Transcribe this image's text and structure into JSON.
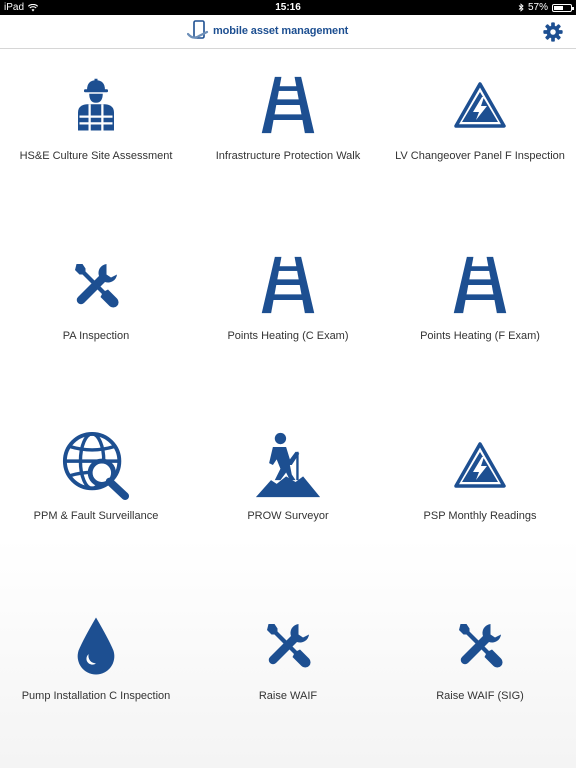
{
  "status": {
    "device": "iPad",
    "time": "15:16",
    "battery": "57%",
    "battery_level": 0.57
  },
  "header": {
    "brand": "mobile asset management",
    "settings_icon": "gear-icon"
  },
  "colors": {
    "primary": "#1d4f91",
    "text": "#333333"
  },
  "tiles": [
    {
      "label": "HS&E Culture Site Assessment",
      "icon": "worker-icon"
    },
    {
      "label": "Infrastructure Protection Walk",
      "icon": "railway-track-icon"
    },
    {
      "label": "LV Changeover Panel F Inspection",
      "icon": "high-voltage-icon"
    },
    {
      "label": "PA Inspection",
      "icon": "tools-icon"
    },
    {
      "label": "Points Heating (C Exam)",
      "icon": "railway-track-icon"
    },
    {
      "label": "Points Heating (F Exam)",
      "icon": "railway-track-icon"
    },
    {
      "label": "PPM & Fault Surveillance",
      "icon": "globe-search-icon"
    },
    {
      "label": "PROW Surveyor",
      "icon": "hiker-icon"
    },
    {
      "label": "PSP Monthly Readings",
      "icon": "high-voltage-icon"
    },
    {
      "label": "Pump Installation C Inspection",
      "icon": "water-drop-icon"
    },
    {
      "label": "Raise WAIF",
      "icon": "tools-icon"
    },
    {
      "label": "Raise WAIF (SIG)",
      "icon": "tools-icon"
    }
  ]
}
